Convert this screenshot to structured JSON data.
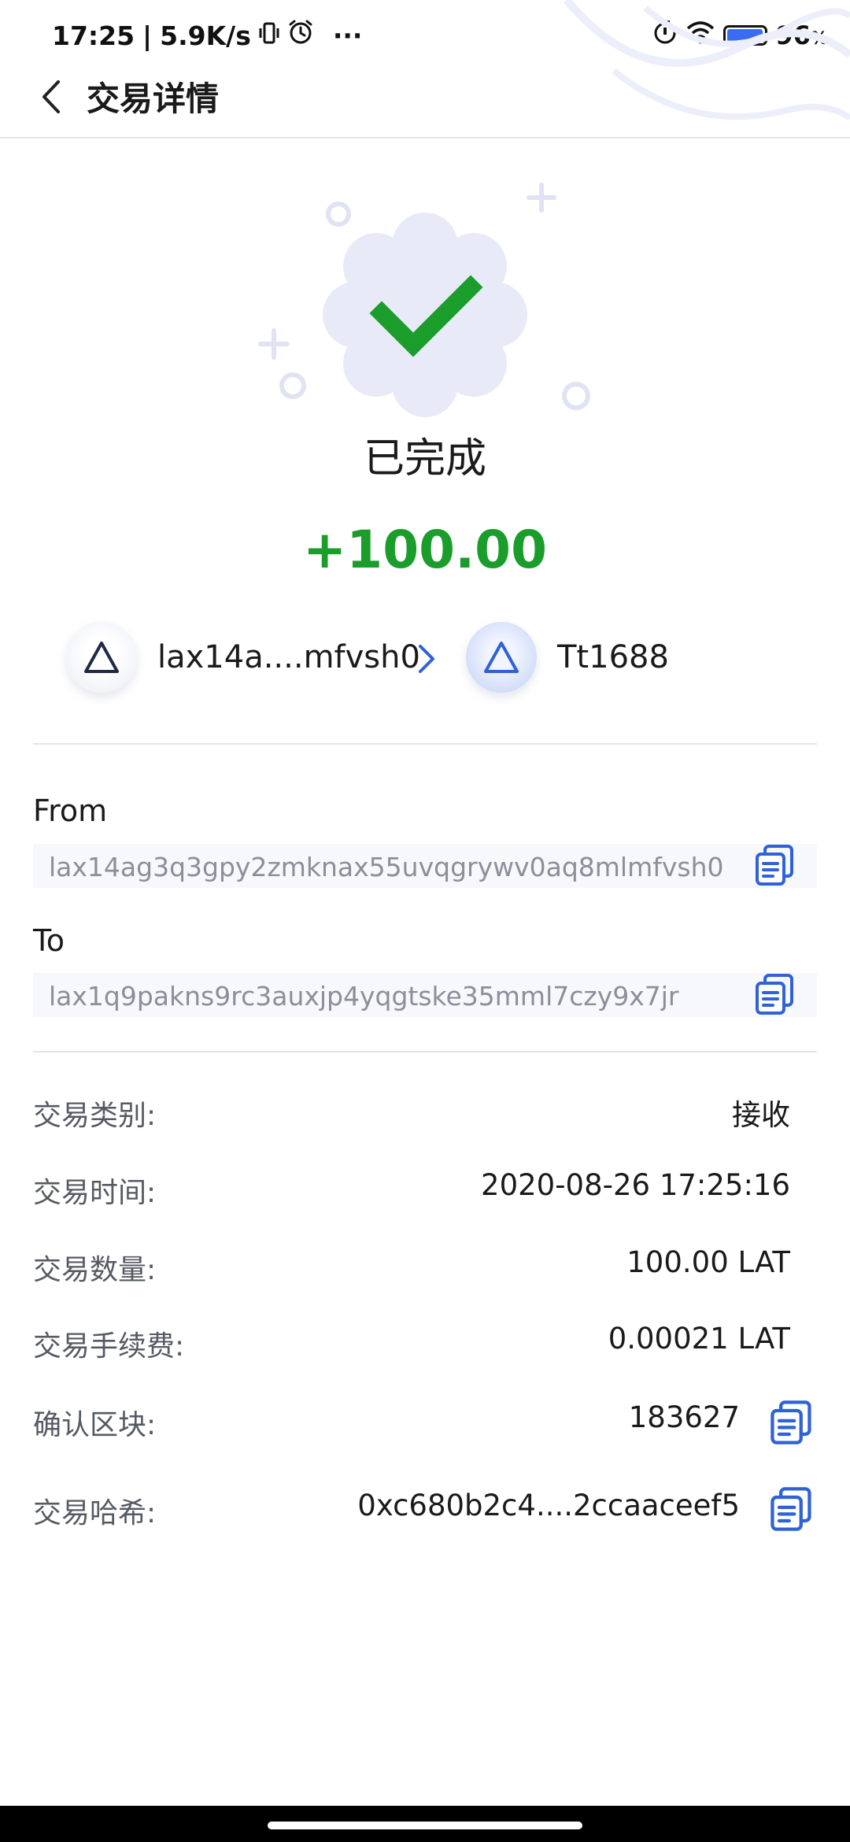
{
  "status_bar": {
    "time": "17:25",
    "separator": "|",
    "net_speed": "5.9K/s",
    "more": "···",
    "battery": "96",
    "battery_unit": "%",
    "battery_level": 0.96
  },
  "header": {
    "title": "交易详情"
  },
  "result": {
    "status": "已完成",
    "amount": "+100.00"
  },
  "summary": {
    "from_name": "lax14a....mfvsh0",
    "to_name": "Tt1688"
  },
  "from": {
    "label": "From",
    "address": "lax14ag3q3gpy2zmknax55uvqgrywv0aq8mlmfvsh0"
  },
  "to": {
    "label": "To",
    "address": "lax1q9pakns9rc3auxjp4yqgtske35mml7czy9x7jr"
  },
  "details": {
    "type_label": "交易类别:",
    "type_value": "接收",
    "time_label": "交易时间:",
    "time_value": "2020-08-26 17:25:16",
    "amount_label": "交易数量:",
    "amount_value": "100.00 LAT",
    "fee_label": "交易手续费:",
    "fee_value": "0.00021 LAT",
    "block_label": "确认区块:",
    "block_value": "183627",
    "hash_label": "交易哈希:",
    "hash_value": "0xc680b2c4....2ccaaceef5"
  },
  "colors": {
    "accent_blue": "#2f62d6",
    "success_green": "#1a9d2a",
    "badge_bg": "#e8ebf7"
  },
  "icons": {
    "back": "chevron-left-icon",
    "check": "check-icon",
    "copy": "copy-icon",
    "arrow": "chevron-right-icon",
    "avatar": "triangle-icon"
  }
}
